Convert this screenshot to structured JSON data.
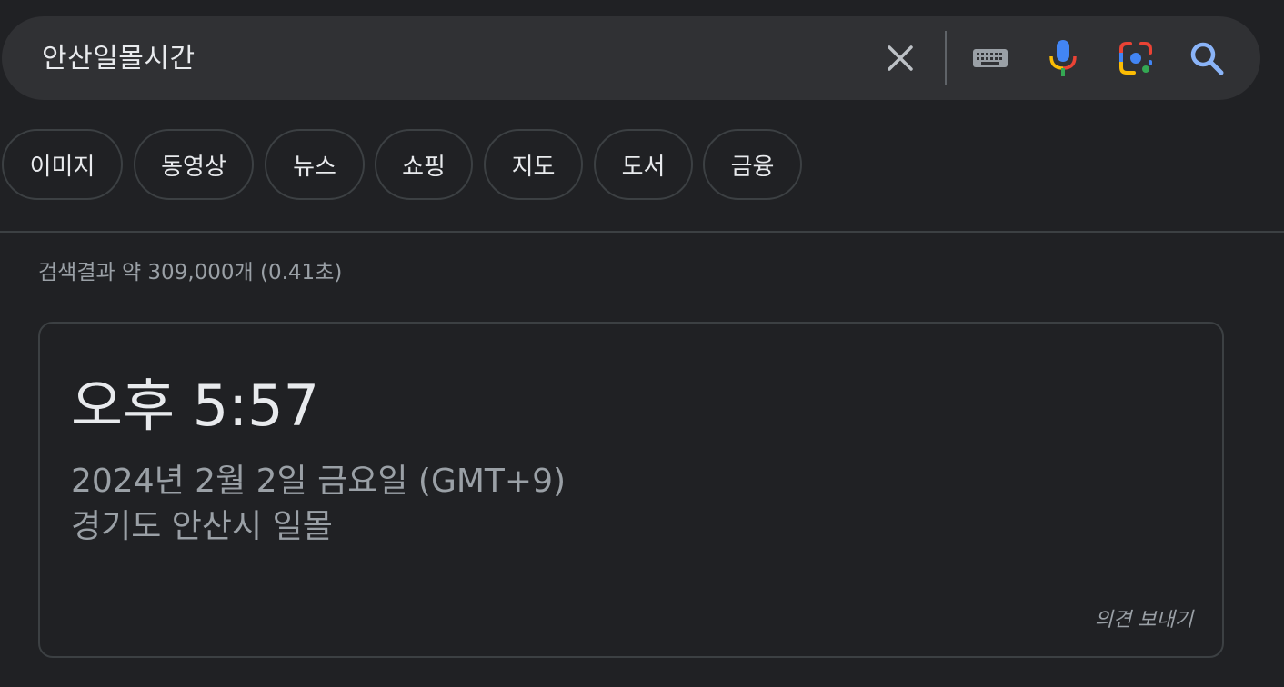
{
  "search": {
    "query": "안산일몰시간",
    "clear_icon": "close-icon",
    "keyboard_icon": "keyboard-icon",
    "mic_icon": "mic-icon",
    "lens_icon": "google-lens-icon",
    "search_icon": "search-icon"
  },
  "chips": [
    {
      "label": "이미지"
    },
    {
      "label": "동영상"
    },
    {
      "label": "뉴스"
    },
    {
      "label": "쇼핑"
    },
    {
      "label": "지도"
    },
    {
      "label": "도서"
    },
    {
      "label": "금융"
    }
  ],
  "results": {
    "stats": "검색결과 약 309,000개 (0.41초)"
  },
  "time_card": {
    "time": "오후 5:57",
    "date": "2024년 2월 2일 금요일 (GMT+9)",
    "location": "경기도 안산시 일몰",
    "feedback": "의견 보내기"
  },
  "colors": {
    "background": "#202124",
    "search_bar": "#303134",
    "text_primary": "#e8eaed",
    "text_secondary": "#9aa0a6",
    "border": "#3c4043",
    "search_icon_blue": "#8ab4f8",
    "google_blue": "#4285f4",
    "google_red": "#ea4335",
    "google_yellow": "#fbbc04",
    "google_green": "#34a853"
  }
}
